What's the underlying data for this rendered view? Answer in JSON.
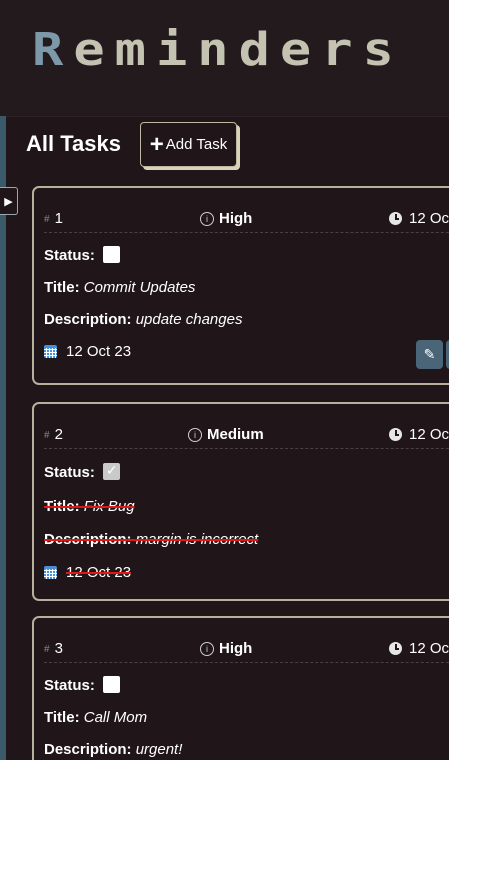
{
  "header": {
    "logo_letters": [
      "R",
      "e",
      "m",
      "i",
      "n",
      "d",
      "e",
      "r",
      "s"
    ],
    "logo_colors": {
      "first_letter": "#7d98a8",
      "rest": "#c4c2b0"
    }
  },
  "sidebar": {
    "toggle_icon": "▶"
  },
  "toolbar": {
    "title": "All Tasks",
    "add_icon": "+",
    "add_label": "Add Task"
  },
  "labels": {
    "status": "Status:",
    "title": "Title:",
    "description": "Description:"
  },
  "tasks": [
    {
      "id": "1",
      "priority": "High",
      "time": "12 Oc",
      "done": false,
      "title": "Commit Updates",
      "description": "update changes",
      "date": "12 Oct 23",
      "edit_icon": "✎"
    },
    {
      "id": "2",
      "priority": "Medium",
      "time": "12 Oc",
      "done": true,
      "title": "Fix Bug",
      "description": "margin is incorrect",
      "date": "12 Oct 23"
    },
    {
      "id": "3",
      "priority": "High",
      "time": "12 Oc",
      "done": false,
      "title": "Call Mom",
      "description": "urgent!"
    }
  ],
  "colors": {
    "background": "#201519",
    "card_border": "#b6b19c",
    "accent": "#4b6578",
    "strike": "#e01818"
  }
}
